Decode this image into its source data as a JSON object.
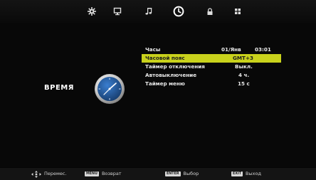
{
  "tabs": [
    {
      "name": "picture-settings-icon",
      "active": false
    },
    {
      "name": "screen-icon",
      "active": false
    },
    {
      "name": "sound-icon",
      "active": false
    },
    {
      "name": "time-icon",
      "active": true
    },
    {
      "name": "lock-icon",
      "active": false
    },
    {
      "name": "apps-icon",
      "active": false
    }
  ],
  "section": {
    "title": "ВРЕМЯ",
    "icon": "analog-clock-icon"
  },
  "menu": {
    "clock": {
      "label": "Часы",
      "date": "01/Янв",
      "time": "03:01"
    },
    "timezone": {
      "label": "Часовой пояс",
      "value": "GMT+3"
    },
    "sleep_timer": {
      "label": "Таймер отключения",
      "value": "Выкл."
    },
    "auto_off": {
      "label": "Автовыключение",
      "value": "4 ч."
    },
    "menu_timer": {
      "label": "Таймер меню",
      "value": "15 с"
    }
  },
  "footer": {
    "move": {
      "icon": "dpad-icon",
      "label": "Перемес."
    },
    "back": {
      "key": "MENU",
      "label": "Возврат"
    },
    "select": {
      "key": "ENTER",
      "label": "Выбор"
    },
    "exit": {
      "key": "EXIT",
      "label": "Выход"
    }
  },
  "colors": {
    "highlight": "#c9d21c",
    "clock_face": "#1f4e8c",
    "background": "#000000"
  }
}
